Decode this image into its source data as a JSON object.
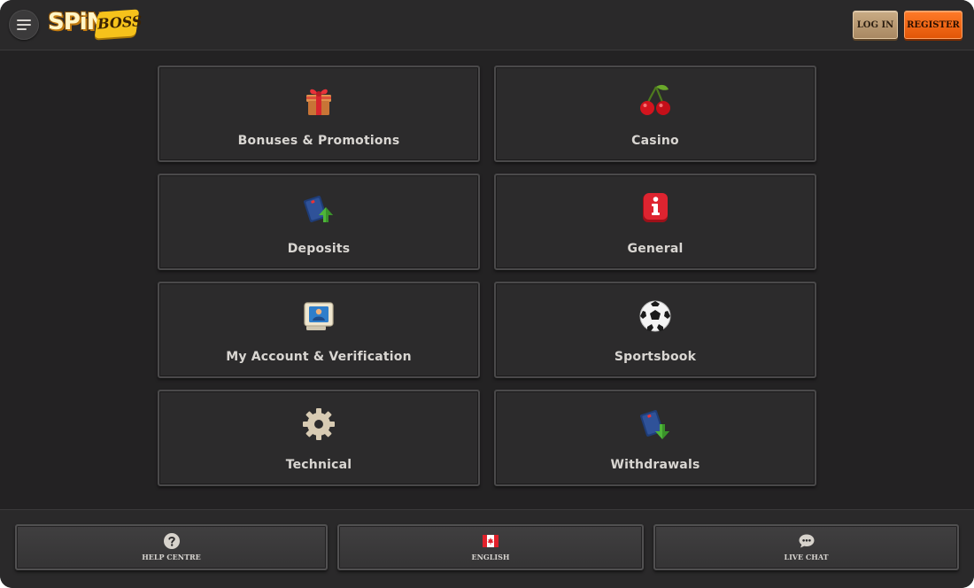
{
  "header": {
    "menu_icon": "hamburger-icon",
    "logo": {
      "part1": "SPiN",
      "part2": "BOSS"
    },
    "login_label": "LOG IN",
    "register_label": "REGISTER"
  },
  "categories": [
    {
      "label": "Bonuses & Promotions",
      "icon": "gift-icon"
    },
    {
      "label": "Casino",
      "icon": "cherries-icon"
    },
    {
      "label": "Deposits",
      "icon": "wallet-deposit-icon"
    },
    {
      "label": "General",
      "icon": "info-icon"
    },
    {
      "label": "My Account & Verification",
      "icon": "id-card-monitor-icon"
    },
    {
      "label": "Sportsbook",
      "icon": "soccer-ball-icon"
    },
    {
      "label": "Technical",
      "icon": "gear-icon"
    },
    {
      "label": "Withdrawals",
      "icon": "wallet-withdraw-icon"
    }
  ],
  "footer": {
    "help_label": "HELP CENTRE",
    "language_label": "ENGLISH",
    "chat_label": "LIVE CHAT"
  },
  "colors": {
    "background": "#232223",
    "card": "#2c2b2c",
    "login": "#b89874",
    "register": "#f26614"
  }
}
